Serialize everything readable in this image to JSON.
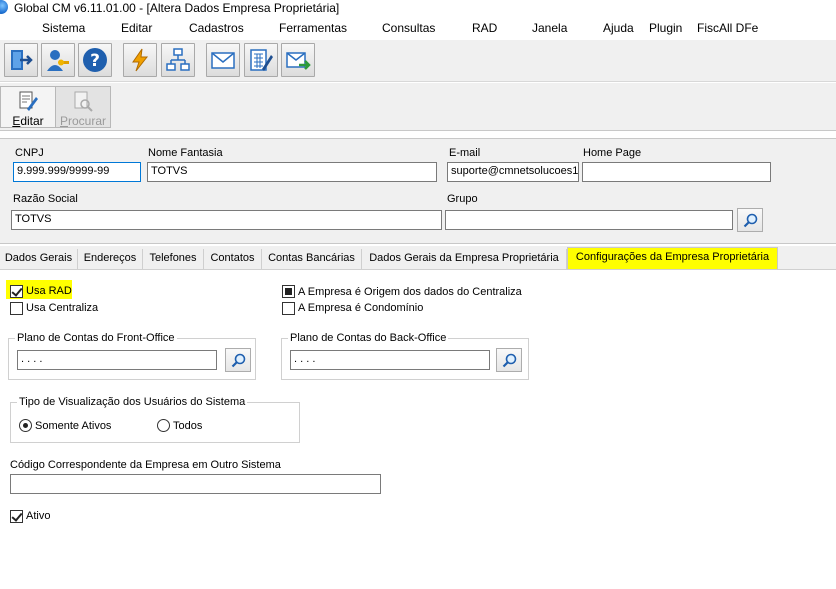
{
  "window": {
    "title": "Global CM v6.11.01.00 - [Altera Dados Empresa Proprietária]"
  },
  "menu": {
    "items": [
      "Sistema",
      "Editar",
      "Cadastros",
      "Ferramentas",
      "Consultas",
      "RAD",
      "Janela",
      "Ajuda",
      "Plugin",
      "FiscAll DFe"
    ]
  },
  "toolbar": {
    "icons": [
      "exit-door-icon",
      "user-key-icon",
      "help-question-icon",
      "lightning-icon",
      "network-diagram-icon",
      "envelope-icon",
      "calculator-pencil-icon",
      "envelope-arrow-icon"
    ]
  },
  "actions": {
    "edit": "Editar",
    "search": "Procurar"
  },
  "header": {
    "cnpj_label": "CNPJ",
    "cnpj_value": "9.999.999/9999-99",
    "fantasy_label": "Nome Fantasia",
    "fantasy_value": "TOTVS",
    "email_label": "E-mail",
    "email_value": "suporte@cmnetsolucoes1.",
    "homepage_label": "Home Page",
    "homepage_value": "",
    "razao_label": "Razão Social",
    "razao_value": "TOTVS",
    "grupo_label": "Grupo",
    "grupo_value": ""
  },
  "tabs": [
    {
      "label": "Dados Gerais",
      "active": false
    },
    {
      "label": "Endereços",
      "active": false
    },
    {
      "label": "Telefones",
      "active": false
    },
    {
      "label": "Contatos",
      "active": false
    },
    {
      "label": "Contas Bancárias",
      "active": false
    },
    {
      "label": "Dados Gerais da Empresa Proprietária",
      "active": false
    },
    {
      "label": "Configurações da Empresa Proprietária",
      "active": true
    }
  ],
  "config": {
    "usa_rad": {
      "label": "Usa RAD",
      "checked": true
    },
    "usa_centraliza": {
      "label": "Usa Centraliza",
      "checked": false
    },
    "origem_centraliza": {
      "label": "A Empresa é Origem dos dados do Centraliza",
      "checked": true
    },
    "condominio": {
      "label": "A Empresa é Condomínio",
      "checked": false
    },
    "front_office": {
      "label": "Plano de Contas do Front-Office",
      "value": ". . . ."
    },
    "back_office": {
      "label": "Plano de Contas do Back-Office",
      "value": ". . . ."
    },
    "visualizacao": {
      "label": "Tipo de Visualização dos Usuários do Sistema",
      "options": [
        "Somente Ativos",
        "Todos"
      ],
      "selected": "Somente Ativos"
    },
    "codigo_outro_sistema": {
      "label": "Código Correspondente da Empresa em Outro Sistema",
      "value": ""
    },
    "ativo": {
      "label": "Ativo",
      "checked": true
    }
  },
  "colors": {
    "highlight": "#ffff00",
    "focus": "#0078d7",
    "panel": "#f0f0f0"
  }
}
